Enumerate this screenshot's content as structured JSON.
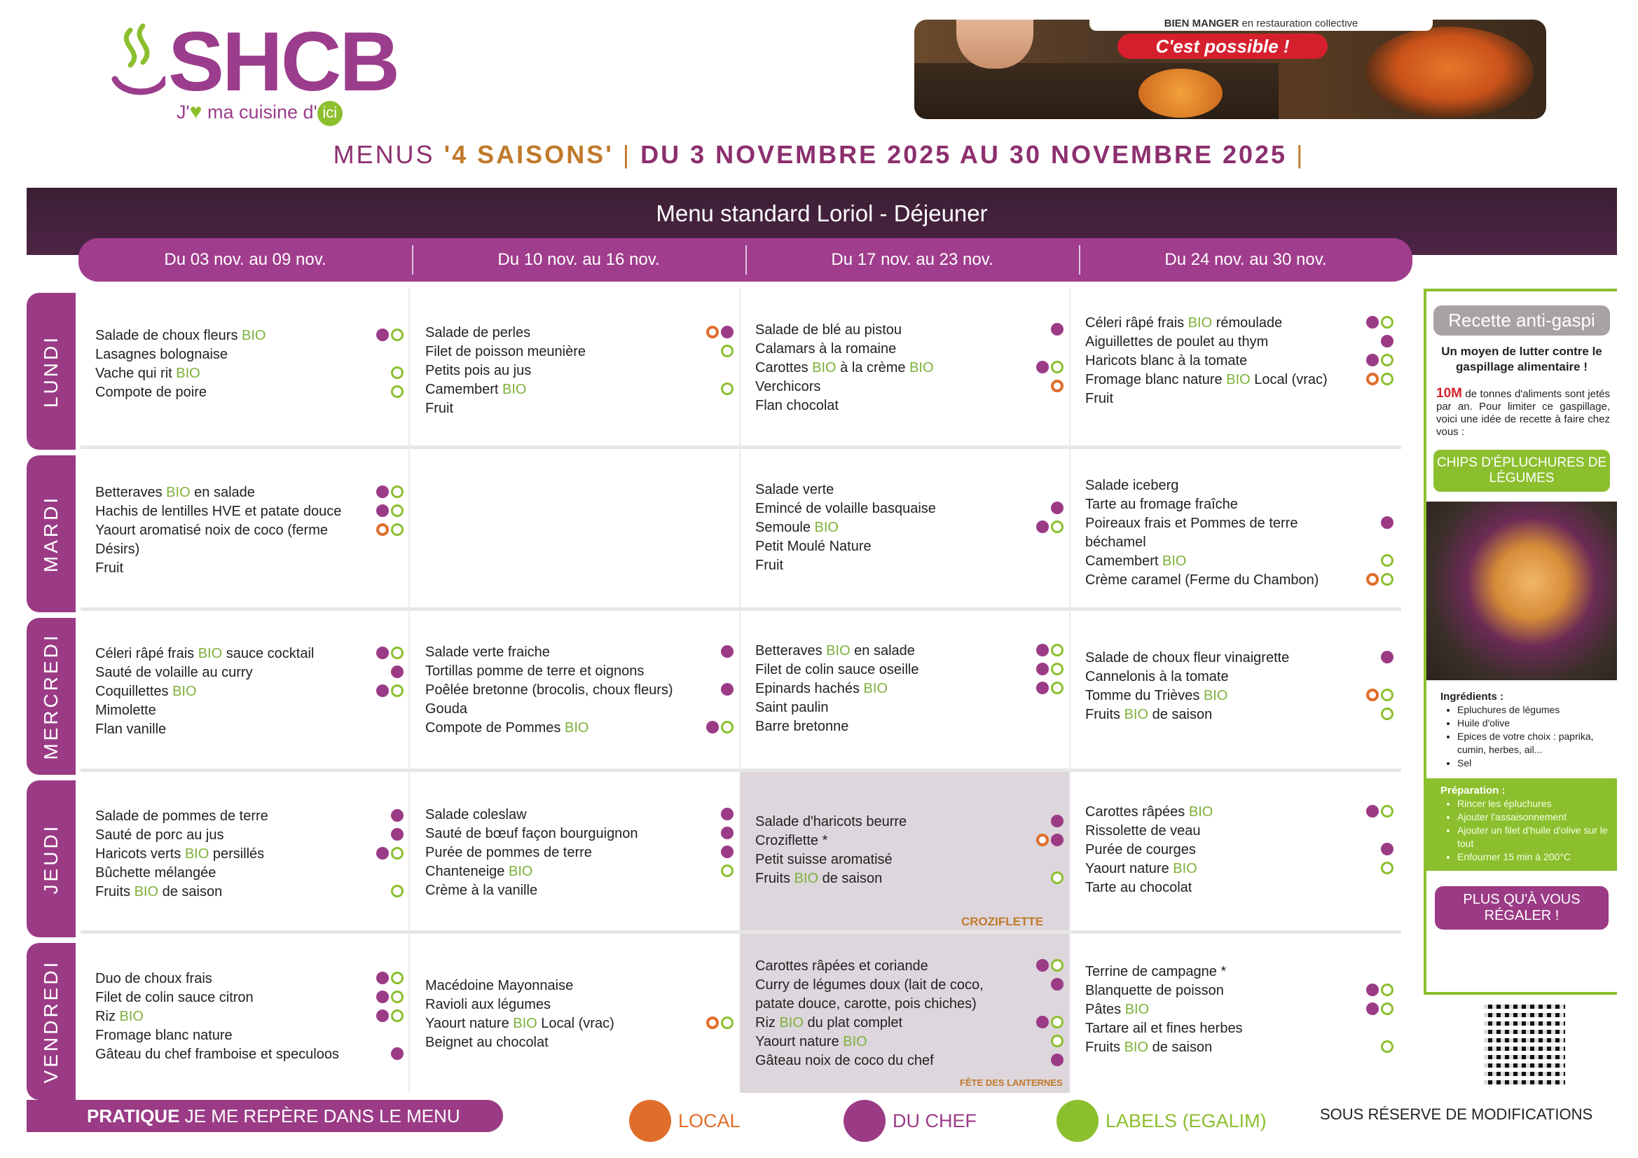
{
  "brand": {
    "name": "SHCB",
    "tagline_pre": "J'",
    "tagline_post": " ma cuisine d'",
    "ici": "ici"
  },
  "banner": {
    "caption_bold": "BIEN MANGER",
    "caption_rest": " en restauration collective",
    "slogan": "C'est possible !"
  },
  "title": {
    "part1": "MENUS ",
    "saisons": "'4 SAISONS'",
    "sep": " | ",
    "dates": "DU 3 NOVEMBRE 2025 AU 30 NOVEMBRE 2025",
    "end": " |"
  },
  "menu_label": "Menu standard Loriol - Déjeuner",
  "weeks": [
    "Du 03 nov. au 09 nov.",
    "Du 10 nov. au 16 nov.",
    "Du 17 nov. au 23 nov.",
    "Du 24 nov. au 30 nov."
  ],
  "days": [
    "LUNDI",
    "MARDI",
    "MERCREDI",
    "JEUDI",
    "VENDREDI"
  ],
  "menu": [
    [
      [
        {
          "t": [
            "Salade de choux fleurs ",
            {
              "b": "BIO"
            }
          ],
          "i": [
            "chef",
            "lab"
          ]
        },
        {
          "t": [
            "Lasagnes bolognaise"
          ],
          "i": []
        },
        {
          "t": [
            "Vache qui rit ",
            {
              "b": "BIO"
            }
          ],
          "i": [
            "lab"
          ]
        },
        {
          "t": [
            "Compote de poire"
          ],
          "i": [
            "lab"
          ]
        }
      ],
      [
        {
          "t": [
            "Salade de perles"
          ],
          "i": [
            "loc",
            "chef"
          ]
        },
        {
          "t": [
            "Filet de poisson meunière"
          ],
          "i": [
            "lab"
          ]
        },
        {
          "t": [
            "Petits pois au jus"
          ],
          "i": []
        },
        {
          "t": [
            "Camembert ",
            {
              "b": "BIO"
            }
          ],
          "i": [
            "lab"
          ]
        },
        {
          "t": [
            "Fruit"
          ],
          "i": []
        }
      ],
      [
        {
          "t": [
            "Salade de blé au pistou"
          ],
          "i": [
            "chef"
          ]
        },
        {
          "t": [
            "Calamars à la romaine"
          ],
          "i": []
        },
        {
          "t": [
            "Carottes ",
            {
              "b": "BIO"
            },
            " à la crème ",
            {
              "b": "BIO"
            }
          ],
          "i": [
            "chef",
            "lab"
          ]
        },
        {
          "t": [
            "Verchicors"
          ],
          "i": [
            "loc"
          ]
        },
        {
          "t": [
            "Flan chocolat"
          ],
          "i": []
        }
      ],
      [
        {
          "t": [
            "Céleri râpé frais ",
            {
              "b": "BIO"
            },
            " rémoulade"
          ],
          "i": [
            "chef",
            "lab"
          ]
        },
        {
          "t": [
            "Aiguillettes de poulet au thym"
          ],
          "i": [
            "chef"
          ]
        },
        {
          "t": [
            "Haricots blanc à la tomate"
          ],
          "i": [
            "chef",
            "lab"
          ]
        },
        {
          "t": [
            "Fromage blanc nature ",
            {
              "b": "BIO"
            },
            " Local (vrac)"
          ],
          "i": [
            "loc",
            "lab"
          ]
        },
        {
          "t": [
            "Fruit"
          ],
          "i": []
        }
      ]
    ],
    [
      [
        {
          "t": [
            "Betteraves ",
            {
              "b": "BIO"
            },
            " en salade"
          ],
          "i": [
            "chef",
            "lab"
          ]
        },
        {
          "t": [
            "Hachis de lentilles HVE et patate douce"
          ],
          "i": [
            "chef",
            "lab"
          ]
        },
        {
          "t": [
            "Yaourt aromatisé noix de coco (ferme Désirs)"
          ],
          "i": [
            "loc",
            "lab"
          ]
        },
        {
          "t": [
            "Fruit"
          ],
          "i": []
        }
      ],
      [],
      [
        {
          "t": [
            "Salade verte"
          ],
          "i": []
        },
        {
          "t": [
            "Emincé de volaille basquaise"
          ],
          "i": [
            "chef"
          ]
        },
        {
          "t": [
            "Semoule ",
            {
              "b": "BIO"
            }
          ],
          "i": [
            "chef",
            "lab"
          ]
        },
        {
          "t": [
            "Petit Moulé Nature"
          ],
          "i": []
        },
        {
          "t": [
            "Fruit"
          ],
          "i": []
        }
      ],
      [
        {
          "t": [
            "Salade iceberg"
          ],
          "i": []
        },
        {
          "t": [
            "Tarte au fromage fraîche"
          ],
          "i": []
        },
        {
          "t": [
            "Poireaux frais et Pommes de terre béchamel"
          ],
          "i": [
            "chef"
          ]
        },
        {
          "t": [
            "Camembert ",
            {
              "b": "BIO"
            }
          ],
          "i": [
            "lab"
          ]
        },
        {
          "t": [
            "Crème caramel (Ferme du Chambon)"
          ],
          "i": [
            "loc",
            "lab"
          ]
        }
      ]
    ],
    [
      [
        {
          "t": [
            "Céleri râpé frais ",
            {
              "b": "BIO"
            },
            " sauce cocktail"
          ],
          "i": [
            "chef",
            "lab"
          ]
        },
        {
          "t": [
            "Sauté de volaille au curry"
          ],
          "i": [
            "chef"
          ]
        },
        {
          "t": [
            "Coquillettes ",
            {
              "b": "BIO"
            }
          ],
          "i": [
            "chef",
            "lab"
          ]
        },
        {
          "t": [
            "Mimolette"
          ],
          "i": []
        },
        {
          "t": [
            "Flan vanille"
          ],
          "i": []
        }
      ],
      [
        {
          "t": [
            "Salade verte fraiche"
          ],
          "i": [
            "chef"
          ]
        },
        {
          "t": [
            "Tortillas pomme de terre et oignons"
          ],
          "i": []
        },
        {
          "t": [
            "Poêlée bretonne (brocolis, choux fleurs)"
          ],
          "i": [
            "chef"
          ]
        },
        {
          "t": [
            "Gouda"
          ],
          "i": []
        },
        {
          "t": [
            "Compote de Pommes ",
            {
              "b": "BIO"
            }
          ],
          "i": [
            "chef",
            "lab"
          ]
        }
      ],
      [
        {
          "t": [
            "Betteraves ",
            {
              "b": "BIO"
            },
            " en salade"
          ],
          "i": [
            "chef",
            "lab"
          ]
        },
        {
          "t": [
            "Filet de colin sauce oseille"
          ],
          "i": [
            "chef",
            "lab"
          ]
        },
        {
          "t": [
            "Epinards hachés ",
            {
              "b": "BIO"
            }
          ],
          "i": [
            "chef",
            "lab"
          ]
        },
        {
          "t": [
            "Saint paulin"
          ],
          "i": []
        },
        {
          "t": [
            "Barre bretonne"
          ],
          "i": []
        }
      ],
      [
        {
          "t": [
            "Salade de choux fleur vinaigrette"
          ],
          "i": [
            "chef"
          ]
        },
        {
          "t": [
            "Cannelonis à la tomate"
          ],
          "i": []
        },
        {
          "t": [
            "Tomme du Trièves ",
            {
              "b": "BIO"
            }
          ],
          "i": [
            "loc",
            "lab"
          ]
        },
        {
          "t": [
            "Fruits ",
            {
              "b": "BIO"
            },
            " de saison"
          ],
          "i": [
            "lab"
          ]
        }
      ]
    ],
    [
      [
        {
          "t": [
            "Salade de pommes de terre"
          ],
          "i": [
            "chef"
          ]
        },
        {
          "t": [
            "Sauté de porc au jus"
          ],
          "i": [
            "chef"
          ]
        },
        {
          "t": [
            "Haricots verts ",
            {
              "b": "BIO"
            },
            " persillés"
          ],
          "i": [
            "chef",
            "lab"
          ]
        },
        {
          "t": [
            "Bûchette mélangée"
          ],
          "i": []
        },
        {
          "t": [
            "Fruits ",
            {
              "b": "BIO"
            },
            " de saison"
          ],
          "i": [
            "lab"
          ]
        }
      ],
      [
        {
          "t": [
            "Salade coleslaw"
          ],
          "i": [
            "chef"
          ]
        },
        {
          "t": [
            "Sauté de bœuf façon bourguignon"
          ],
          "i": [
            "chef"
          ]
        },
        {
          "t": [
            "Purée de pommes de terre"
          ],
          "i": [
            "chef"
          ]
        },
        {
          "t": [
            "Chanteneige ",
            {
              "b": "BIO"
            }
          ],
          "i": [
            "lab"
          ]
        },
        {
          "t": [
            "Crème à la vanille"
          ],
          "i": []
        }
      ],
      [
        {
          "t": [
            "Salade d'haricots beurre"
          ],
          "i": [
            "chef"
          ]
        },
        {
          "t": [
            "Croziflette *"
          ],
          "i": [
            "loc",
            "chef"
          ]
        },
        {
          "t": [
            "Petit suisse aromatisé"
          ],
          "i": []
        },
        {
          "t": [
            "Fruits ",
            {
              "b": "BIO"
            },
            " de saison"
          ],
          "i": [
            "lab"
          ]
        }
      ],
      [
        {
          "t": [
            "Carottes râpées ",
            {
              "b": "BIO"
            }
          ],
          "i": [
            "chef",
            "lab"
          ]
        },
        {
          "t": [
            "Rissolette de veau"
          ],
          "i": []
        },
        {
          "t": [
            "Purée de courges"
          ],
          "i": [
            "chef"
          ]
        },
        {
          "t": [
            "Yaourt nature ",
            {
              "b": "BIO"
            }
          ],
          "i": [
            "lab"
          ]
        },
        {
          "t": [
            "Tarte au chocolat"
          ],
          "i": []
        }
      ]
    ],
    [
      [
        {
          "t": [
            "Duo de choux frais"
          ],
          "i": [
            "chef",
            "lab"
          ]
        },
        {
          "t": [
            "Filet de colin sauce citron"
          ],
          "i": [
            "chef",
            "lab"
          ]
        },
        {
          "t": [
            "Riz ",
            {
              "b": "BIO"
            }
          ],
          "i": [
            "chef",
            "lab"
          ]
        },
        {
          "t": [
            "Fromage blanc nature"
          ],
          "i": []
        },
        {
          "t": [
            "Gâteau du chef framboise et speculoos"
          ],
          "i": [
            "chef"
          ]
        }
      ],
      [
        {
          "t": [
            "Macédoine Mayonnaise"
          ],
          "i": []
        },
        {
          "t": [
            "Ravioli aux légumes"
          ],
          "i": []
        },
        {
          "t": [
            "Yaourt nature ",
            {
              "b": "BIO"
            },
            " Local (vrac)"
          ],
          "i": [
            "loc",
            "lab"
          ]
        },
        {
          "t": [
            "Beignet au chocolat"
          ],
          "i": []
        }
      ],
      [
        {
          "t": [
            "Carottes râpées et coriande"
          ],
          "i": [
            "chef",
            "lab"
          ]
        },
        {
          "t": [
            "Curry de légumes doux (lait de coco, patate douce, carotte, pois chiches)"
          ],
          "i": [
            "chef"
          ]
        },
        {
          "t": [
            "Riz ",
            {
              "b": "BIO"
            },
            " du plat complet"
          ],
          "i": [
            "chef",
            "lab"
          ]
        },
        {
          "t": [
            "Yaourt nature ",
            {
              "b": "BIO"
            }
          ],
          "i": [
            "lab"
          ]
        },
        {
          "t": [
            "Gâteau noix de coco du chef"
          ],
          "i": [
            "chef"
          ]
        }
      ],
      [
        {
          "t": [
            "Terrine de campagne *"
          ],
          "i": []
        },
        {
          "t": [
            "Blanquette de poisson"
          ],
          "i": [
            "chef",
            "lab"
          ]
        },
        {
          "t": [
            "Pâtes ",
            {
              "b": "BIO"
            }
          ],
          "i": [
            "chef",
            "lab"
          ]
        },
        {
          "t": [
            "Tartare ail et fines herbes"
          ],
          "i": []
        },
        {
          "t": [
            "Fruits ",
            {
              "b": "BIO"
            },
            " de saison"
          ],
          "i": [
            "lab"
          ]
        }
      ]
    ]
  ],
  "notes": {
    "croziflette": "CROZIFLETTE",
    "lanternes": "FÊTE DES LANTERNES"
  },
  "sidebar": {
    "title": "Recette anti-gaspi",
    "subtitle": "Un moyen de lutter contre le gaspillage alimentaire !",
    "stat": "10M",
    "text": " de tonnes d'aliments sont jetés par an. Pour limiter ce gaspillage, voici une idée de recette à faire chez vous :",
    "recipe": "CHIPS D'ÉPLUCHURES DE LÉGUMES",
    "ingredients_title": "Ingrédients :",
    "ingredients": [
      "Epluchures de légumes",
      "Huile d'olive",
      "Epices de votre choix : paprika, cumin, herbes, ail...",
      "Sel"
    ],
    "prep_title": "Préparation :",
    "prep": [
      "Rincer les épluchures",
      "Ajouter l'assaisonnement",
      "Ajouter un filet d'huile d'olive sur le tout",
      "Enfourner 15 min à 200°C"
    ],
    "more": "PLUS QU'À VOUS RÉGALER !"
  },
  "footer": {
    "pill_bold": "PRATIQUE",
    "pill_rest": " JE ME REPÈRE DANS LE MENU",
    "local": "LOCAL",
    "chef": "DU CHEF",
    "labels": "LABELS (EGALIM)",
    "reserve": "SOUS RÉSERVE DE MODIFICATIONS"
  },
  "colors": {
    "purple": "#9b3b86",
    "green": "#8cbf2e",
    "orange": "#e06d2b",
    "band": "#3a1f33"
  }
}
